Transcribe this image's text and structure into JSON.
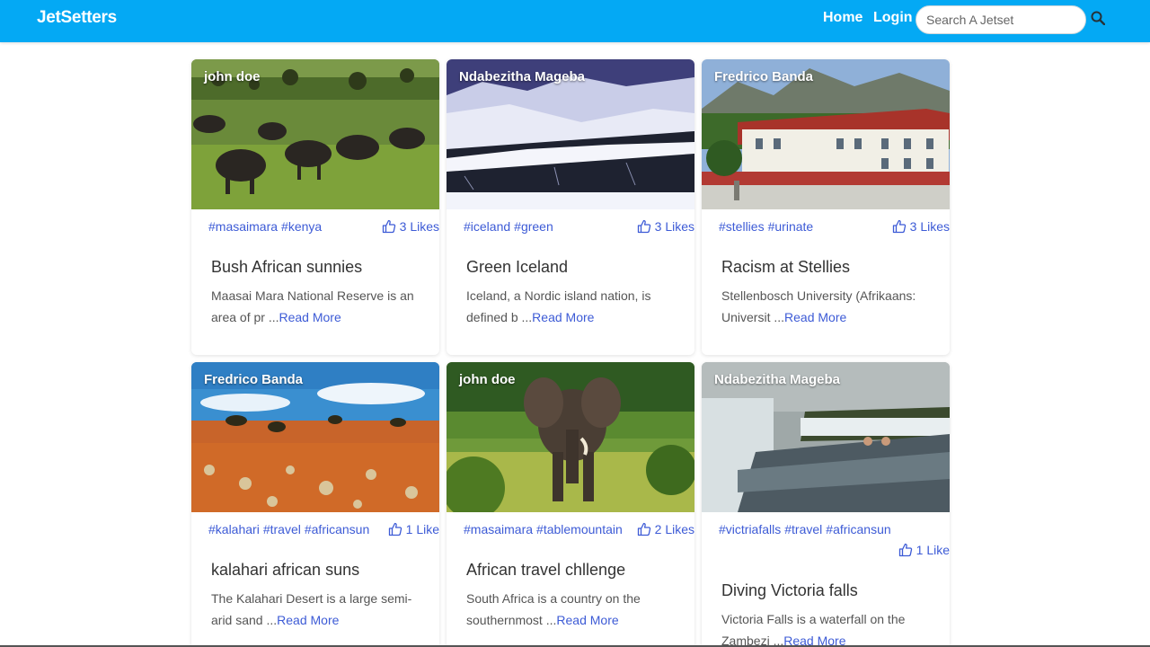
{
  "nav": {
    "brand": "JetSetters",
    "home": "Home",
    "login": "Login",
    "search_placeholder": "Search A Jetset"
  },
  "colors": {
    "navbar": "#04a9f4",
    "link": "#3d5bd6"
  },
  "posts": [
    {
      "author": "john doe",
      "tags": [
        "#masaimara",
        "#kenya"
      ],
      "likes": "3 Likes",
      "title": "Bush African sunnies",
      "excerpt": "Maasai Mara National Reserve is an area of pr ...",
      "read_more": "Read More",
      "image": "buffalo-herd-savanna-photo"
    },
    {
      "author": "Ndabezitha Mageba",
      "tags": [
        "#iceland",
        "#green"
      ],
      "likes": "3 Likes",
      "title": "Green Iceland",
      "excerpt": "Iceland, a Nordic island nation, is defined b ...",
      "read_more": "Read More",
      "image": "snowy-mountains-photo"
    },
    {
      "author": "Fredrico Banda",
      "tags": [
        "#stellies",
        "#urinate"
      ],
      "likes": "3 Likes",
      "title": "Racism at Stellies",
      "excerpt": "Stellenbosch University (Afrikaans: Universit ...",
      "read_more": "Read More",
      "image": "university-building-photo"
    },
    {
      "author": "Fredrico Banda",
      "tags": [
        "#kalahari",
        "#travel",
        "#africansun"
      ],
      "likes": "1 Like",
      "title": "kalahari african suns",
      "excerpt": "The Kalahari Desert is a large semi-arid sand ...",
      "read_more": "Read More",
      "image": "kalahari-desert-photo"
    },
    {
      "author": "john doe",
      "tags": [
        "#masaimara",
        "#tablemountain"
      ],
      "likes": "2 Likes",
      "title": "African travel chllenge",
      "excerpt": "South Africa is a country on the southernmost ...",
      "read_more": "Read More",
      "image": "elephant-photo"
    },
    {
      "author": "Ndabezitha Mageba",
      "tags": [
        "#victriafalls",
        "#travel",
        "#africansun"
      ],
      "likes": "1 Like",
      "title": "Diving Victoria falls",
      "excerpt": "Victoria Falls is a waterfall on the Zambezi ...",
      "read_more": "Read More",
      "image": "victoria-falls-pool-photo"
    }
  ]
}
